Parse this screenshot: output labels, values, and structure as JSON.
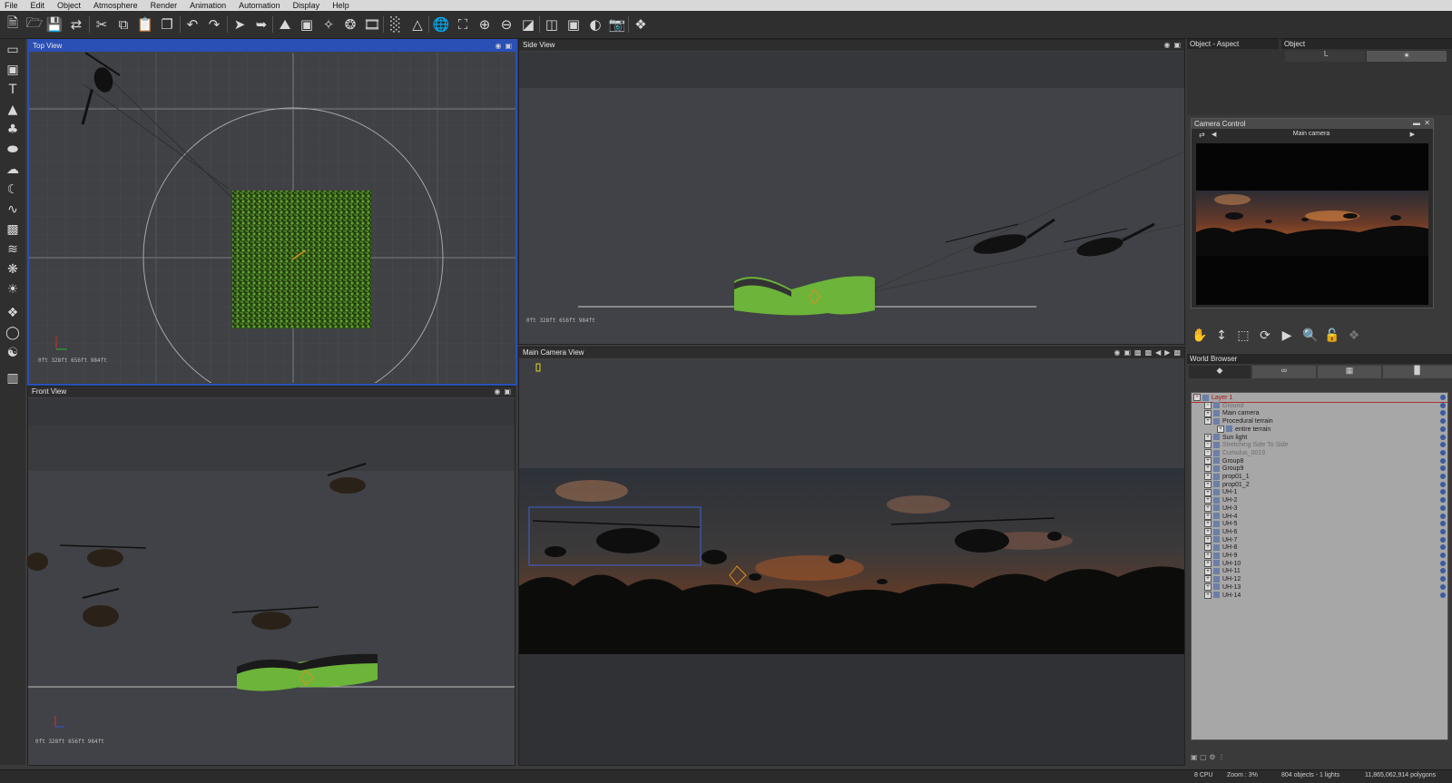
{
  "menu": [
    "File",
    "Edit",
    "Object",
    "Atmosphere",
    "Render",
    "Animation",
    "Automation",
    "Display",
    "Help"
  ],
  "viewports": {
    "top": {
      "title": "Top View",
      "scale": "0ft  328ft  656ft  984ft"
    },
    "side": {
      "title": "Side View",
      "scale": "0ft  328ft  656ft  984ft"
    },
    "front": {
      "title": "Front View",
      "scale": "0ft  328ft  656ft  984ft"
    },
    "main": {
      "title": "Main Camera View"
    }
  },
  "aspect_tabs": {
    "left": "Object - Aspect",
    "right": "Object"
  },
  "camera_control": {
    "title": "Camera Control",
    "camera_name": "Main camera"
  },
  "world_browser": {
    "title": "World Browser",
    "items": [
      {
        "label": "Layer 1",
        "kind": "layer"
      },
      {
        "label": "Ground",
        "kind": "dim"
      },
      {
        "label": "Main camera",
        "kind": "normal"
      },
      {
        "label": "Procedural terrain",
        "kind": "normal"
      },
      {
        "label": "entire terrain",
        "kind": "child"
      },
      {
        "label": "Sun light",
        "kind": "normal"
      },
      {
        "label": "Stretching Side To Side",
        "kind": "dim"
      },
      {
        "label": "Cumulus_0019",
        "kind": "dim"
      },
      {
        "label": "Group8",
        "kind": "normal"
      },
      {
        "label": "Group9",
        "kind": "normal"
      },
      {
        "label": "prop01_1",
        "kind": "normal"
      },
      {
        "label": "prop01_2",
        "kind": "normal"
      },
      {
        "label": "UH-1",
        "kind": "normal"
      },
      {
        "label": "UH-2",
        "kind": "normal"
      },
      {
        "label": "UH-3",
        "kind": "normal"
      },
      {
        "label": "UH-4",
        "kind": "normal"
      },
      {
        "label": "UH-5",
        "kind": "normal"
      },
      {
        "label": "UH-6",
        "kind": "normal"
      },
      {
        "label": "UH-7",
        "kind": "normal"
      },
      {
        "label": "UH-8",
        "kind": "normal"
      },
      {
        "label": "UH-9",
        "kind": "normal"
      },
      {
        "label": "UH-10",
        "kind": "normal"
      },
      {
        "label": "UH-11",
        "kind": "normal"
      },
      {
        "label": "UH-12",
        "kind": "normal"
      },
      {
        "label": "UH-13",
        "kind": "normal"
      },
      {
        "label": "UH-14",
        "kind": "normal"
      }
    ]
  },
  "status": {
    "cpu": "8 CPU",
    "zoom": "Zoom : 3%",
    "objects": "804 objects - 1 lights",
    "polygons": "11,865,062,914 polygons"
  }
}
